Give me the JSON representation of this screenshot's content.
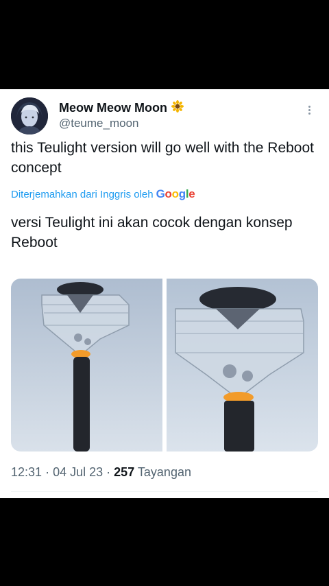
{
  "tweet": {
    "display_name": "Meow Meow Moon",
    "handle": "@teume_moon",
    "text": "this Teulight version will go well with the Reboot concept",
    "translation_label": "Diterjemahkan dari Inggris oleh",
    "translation_provider": "Google",
    "translated_text": "versi Teulight ini akan cocok dengan konsep Reboot",
    "time": "12:31",
    "separator": "·",
    "date": "04 Jul 23",
    "views_count": "257",
    "views_label": "Tayangan"
  },
  "colors": {
    "link": "#1d9bf0",
    "text": "#0f1419",
    "secondary": "#536471",
    "background": "#000000",
    "card": "#ffffff"
  },
  "icons": {
    "verified_badge": "sunflower-icon",
    "more": "more-vertical-icon"
  }
}
